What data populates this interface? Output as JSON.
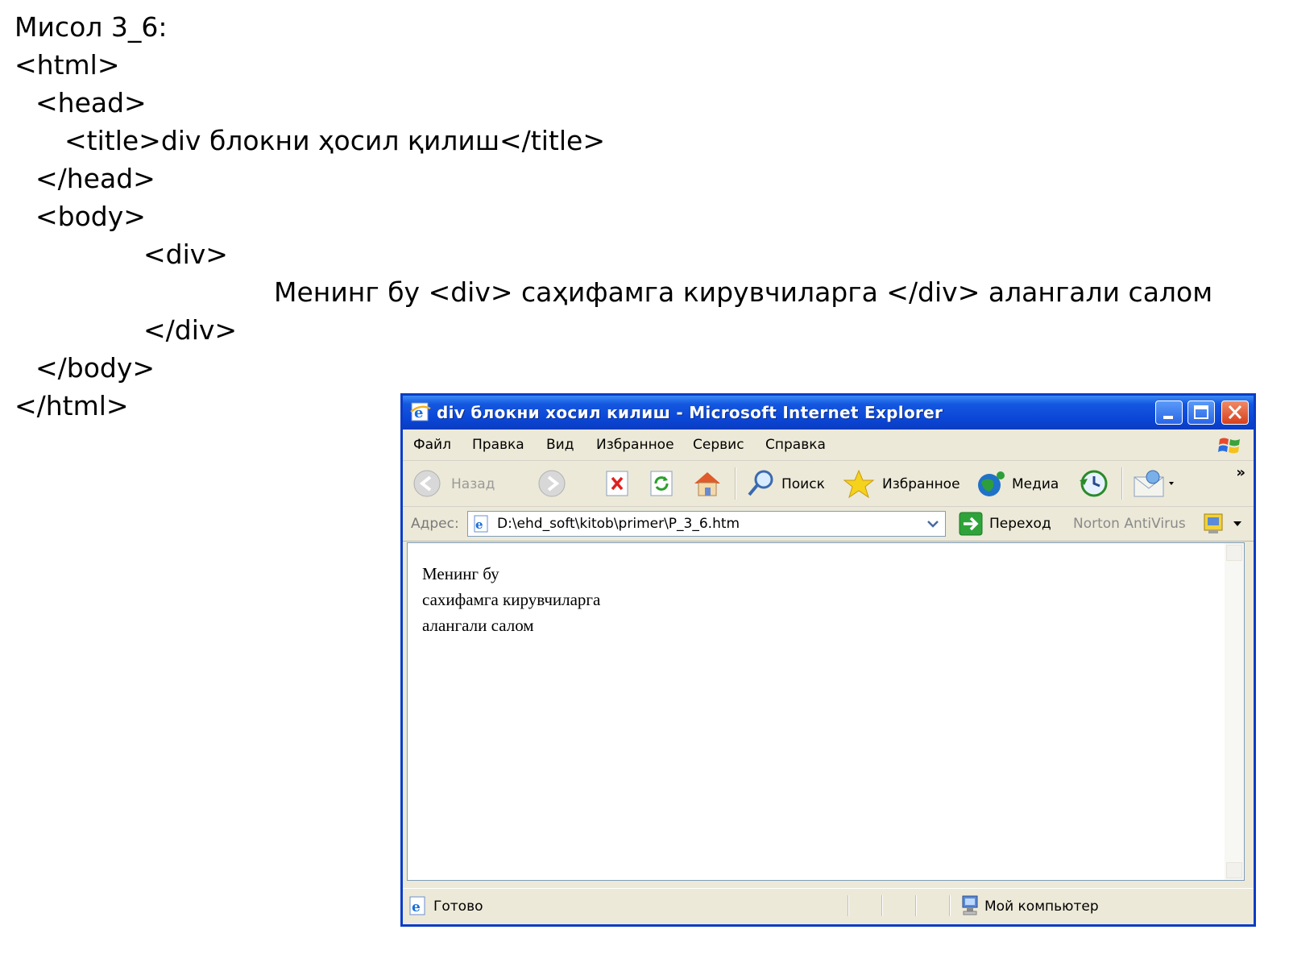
{
  "slide": {
    "lines": [
      "Мисол 3_6:",
      "<html>",
      "<head>",
      "<title>div блокни ҳосил қилиш</title>",
      "</head>",
      "<body>",
      "<div>",
      "Менинг бу <div> саҳифамга кирувчиларга </div> алангали салом",
      "</div>",
      "</body>",
      "</html>"
    ]
  },
  "browser": {
    "title": "div блокни хосил килиш - Microsoft Internet Explorer",
    "menu": [
      "Файл",
      "Правка",
      "Вид",
      "Избранное",
      "Сервис",
      "Справка"
    ],
    "toolbar": {
      "back": "Назад",
      "search": "Поиск",
      "favorites": "Избранное",
      "media": "Медиа",
      "more": "»"
    },
    "address": {
      "label": "Адрес:",
      "value": "D:\\ehd_soft\\kitob\\primer\\P_3_6.htm",
      "go": "Переход",
      "norton": "Norton AntiVirus"
    },
    "content_lines": [
      "Менинг бу",
      "сахифамга кирувчиларга",
      "алангали салом"
    ],
    "status": {
      "text": "Готово",
      "zone": "Мой компьютер"
    },
    "icons": [
      "ie-icon",
      "minimize-icon",
      "maximize-icon",
      "close-icon",
      "windows-flag-icon",
      "back-arrow-icon",
      "forward-arrow-icon",
      "stop-icon",
      "refresh-icon",
      "home-icon",
      "search-icon",
      "favorites-star-icon",
      "media-icon",
      "history-icon",
      "mail-icon",
      "page-icon",
      "go-arrow-icon",
      "norton-icon",
      "status-ie-icon",
      "my-computer-icon"
    ],
    "colors": {
      "titlebar": "#0b46d6",
      "chrome": "#ece9d8",
      "close": "#d6401c"
    }
  }
}
